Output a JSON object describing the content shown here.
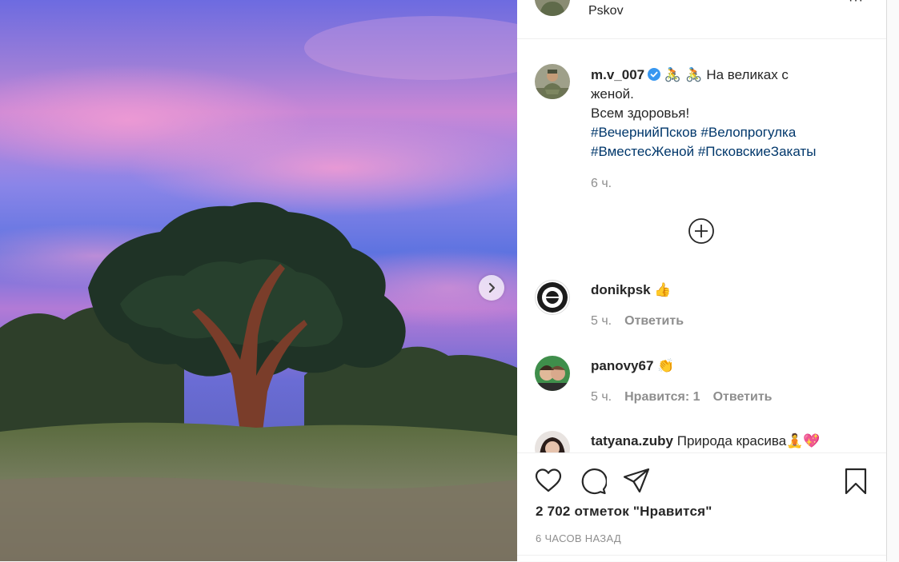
{
  "post": {
    "location": "Pskov",
    "more_icon": "···",
    "caption": {
      "username": "m.v_007",
      "emoji": "🚴 🚴",
      "line1": "На великах с",
      "line2": "женой.",
      "line3": "Всем здоровья!",
      "hashtags": [
        "#ВечернийПсков",
        "#Велопрогулка",
        "#ВместесЖеной",
        "#ПсковскиеЗакаты"
      ],
      "time": "6 ч."
    },
    "comments": [
      {
        "username": "donikpsk",
        "text": "👍",
        "time": "5 ч.",
        "likes": "",
        "reply": "Ответить"
      },
      {
        "username": "panovy67",
        "text": "👏",
        "time": "5 ч.",
        "likes": "Нравится: 1",
        "reply": "Ответить"
      },
      {
        "username": "tatyana.zuby",
        "text": "Природа красива",
        "emoji": "🧘💖",
        "time": "",
        "likes": "",
        "reply": ""
      }
    ],
    "likes_text": "2 702 отметок \"Нравится\"",
    "time_ago": "6 ЧАСОВ НАЗАД"
  },
  "icons": {
    "next": "chevron-right-icon",
    "load_more": "plus-circle-icon",
    "like": "heart-icon",
    "comment": "comment-icon",
    "share": "paper-plane-icon",
    "save": "bookmark-icon",
    "verified": "verified-badge-icon"
  },
  "colors": {
    "hashtag": "#00376b",
    "verified": "#3897f0",
    "secondary": "#8e8e8e"
  }
}
